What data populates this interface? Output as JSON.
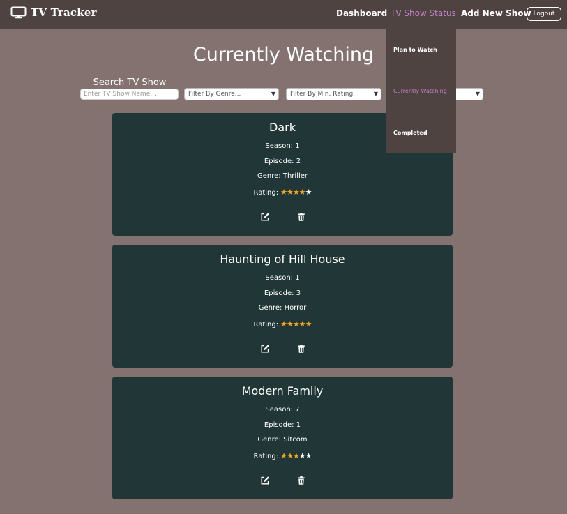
{
  "nav": {
    "brand": "TV Tracker",
    "links": {
      "dashboard": "Dashboard",
      "status": "TV Show Status",
      "add": "Add New Show"
    },
    "logout": "Logout"
  },
  "dropdown": {
    "items": [
      "Plan to Watch",
      "Currently Watching",
      "Completed"
    ],
    "active": "Currently Watching"
  },
  "page": {
    "title": "Currently Watching",
    "search_label": "Search TV Show",
    "search_placeholder": "Enter TV Show Name...",
    "filter_genre": "Filter By Genre...",
    "filter_rating": "Filter By Min. Rating..."
  },
  "shows": [
    {
      "title": "Dark",
      "season": "Season: 1",
      "episode": "Episode: 2",
      "genre": "Genre: Thriller",
      "rating_label": "Rating:",
      "rating": 4
    },
    {
      "title": "Haunting of Hill House",
      "season": "Season: 1",
      "episode": "Episode: 3",
      "genre": "Genre: Horror",
      "rating_label": "Rating:",
      "rating": 5
    },
    {
      "title": "Modern Family",
      "season": "Season: 7",
      "episode": "Episode: 1",
      "genre": "Genre: Sitcom",
      "rating_label": "Rating:",
      "rating": 3
    }
  ],
  "colors": {
    "background": "#847271",
    "navbar": "#4e4340",
    "card": "#213636",
    "accent": "#c083c8",
    "star": "#f5a623"
  },
  "icons": [
    "tv-icon",
    "edit-icon",
    "trash-icon",
    "star-icon",
    "caret-down-icon"
  ]
}
